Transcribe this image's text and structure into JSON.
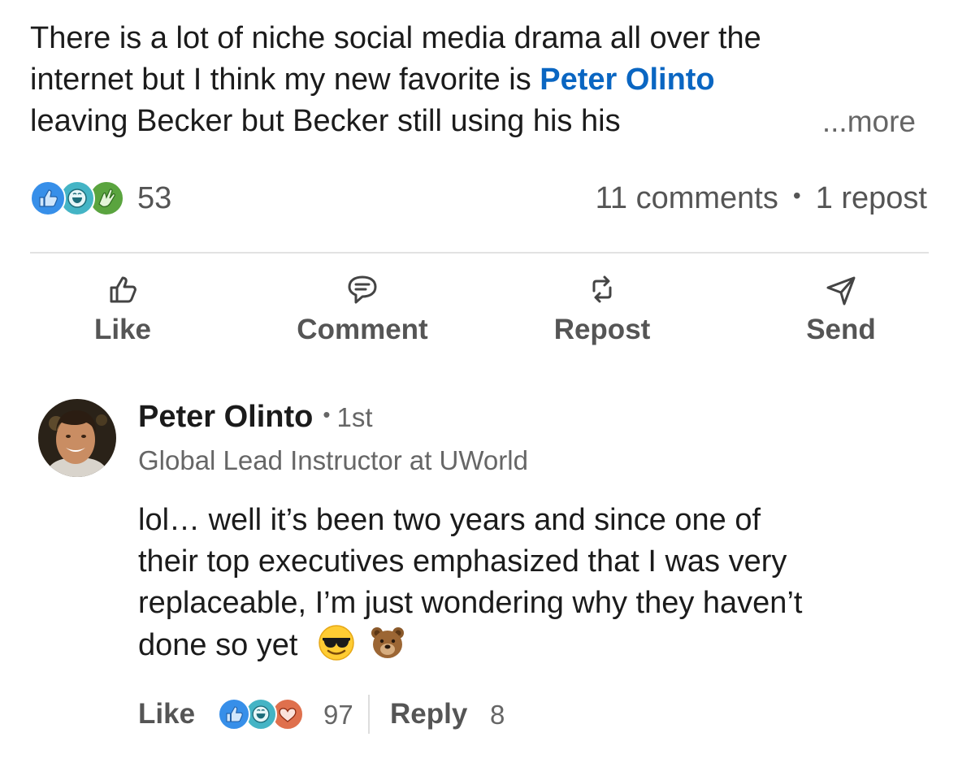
{
  "post": {
    "text_line_1": "There is a lot of niche social media drama all over the",
    "text_line_2_prefix": "internet but I think my new favorite is ",
    "mention": "Peter Olinto",
    "text_line_3": "leaving Becker but Becker still using his his",
    "more_label": "...more"
  },
  "social_counts": {
    "reactions": [
      "like-icon",
      "insightful-icon",
      "celebrate-icon"
    ],
    "reactions_count": "53",
    "comments": "11 comments",
    "separator": "•",
    "reposts": "1 repost"
  },
  "actions": {
    "like": "Like",
    "comment": "Comment",
    "repost": "Repost",
    "send": "Send"
  },
  "comment": {
    "author": "Peter Olinto",
    "degree_separator": "•",
    "degree": "1st",
    "headline": "Global Lead Instructor at UWorld",
    "body_line_1": "lol… well it’s been two years and since one of",
    "body_line_2": "their top executives emphasized that I was very",
    "body_line_3": "replaceable, I’m just wondering why they haven’t",
    "body_line_4": "done so yet",
    "emojis": [
      "sunglasses-emoji",
      "bear-emoji"
    ],
    "like_label": "Like",
    "reactions": [
      "like-icon",
      "insightful-icon",
      "love-icon"
    ],
    "reactions_count": "97",
    "reply_label": "Reply",
    "reply_count": "8"
  },
  "colors": {
    "mention_blue": "#0a66c2",
    "like_blue": "#378fe9",
    "insightful_teal": "#44b4c5",
    "celebrate_green": "#5aa43f",
    "love_orange": "#df704d",
    "secondary_text": "#666666"
  }
}
